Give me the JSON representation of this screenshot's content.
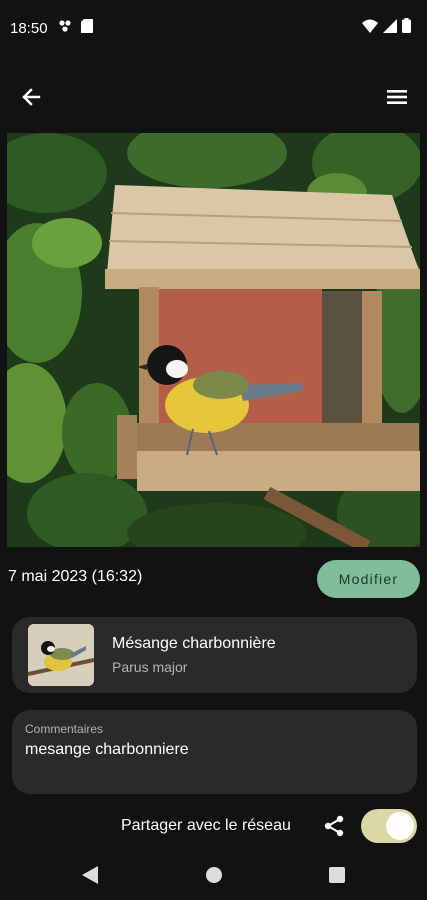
{
  "status_bar": {
    "time": "18:50"
  },
  "observation": {
    "date": "7 mai 2023 (16:32)",
    "modify_label": "Modifier"
  },
  "species": {
    "common_name": "Mésange charbonnière",
    "latin_name": "Parus major"
  },
  "comment": {
    "label": "Commentaires",
    "value": "mesange charbonniere"
  },
  "share": {
    "label": "Partager avec le réseau",
    "enabled": true
  },
  "colors": {
    "background": "#121212",
    "card": "#2a2a2a",
    "accent_button": "#7fbe99",
    "toggle_track": "#d8d9a4"
  },
  "icons": {
    "status_left": [
      "fan-icon",
      "sim-card-icon"
    ],
    "status_right": [
      "wifi-icon",
      "signal-icon",
      "battery-icon"
    ],
    "app_bar": [
      "back-arrow-icon",
      "menu-icon"
    ],
    "share": "share-icon",
    "nav": [
      "nav-back-icon",
      "nav-home-icon",
      "nav-recents-icon"
    ]
  }
}
